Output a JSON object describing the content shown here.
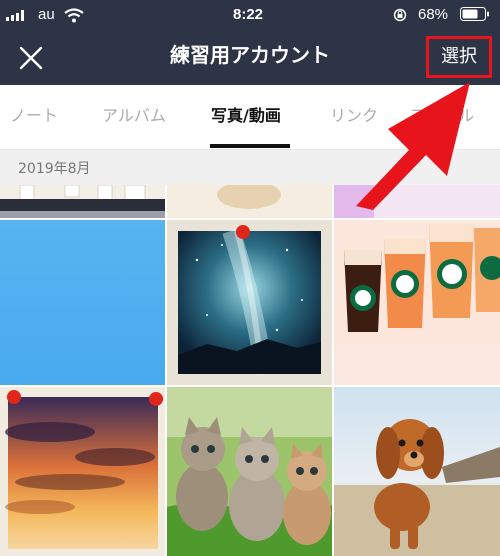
{
  "status_bar": {
    "carrier": "au",
    "time": "8:22",
    "battery": "68%"
  },
  "header": {
    "title": "練習用アカウント",
    "select_label": "選択",
    "highlight_color": "#e8141c"
  },
  "tabs": [
    {
      "label": "ノート",
      "active": false
    },
    {
      "label": "アルバム",
      "active": false
    },
    {
      "label": "写真/動画",
      "active": true
    },
    {
      "label": "リンク",
      "active": false
    },
    {
      "label": "ファイル",
      "active": false
    }
  ],
  "date_label": "2019年8月",
  "icons": [
    "wifi-icon",
    "lock-rotation-icon",
    "battery-icon",
    "close-icon",
    "pin-icon"
  ],
  "photos": [
    {
      "name": "drinks-on-table-photo"
    },
    {
      "name": "dog-partial-photo"
    },
    {
      "name": "pink-partial-photo"
    },
    {
      "name": "blue-sky-photo"
    },
    {
      "name": "milky-way-photo"
    },
    {
      "name": "starbucks-frappuccino-photo"
    },
    {
      "name": "sunset-clouds-photo"
    },
    {
      "name": "kittens-photo"
    },
    {
      "name": "puppy-photo"
    }
  ]
}
